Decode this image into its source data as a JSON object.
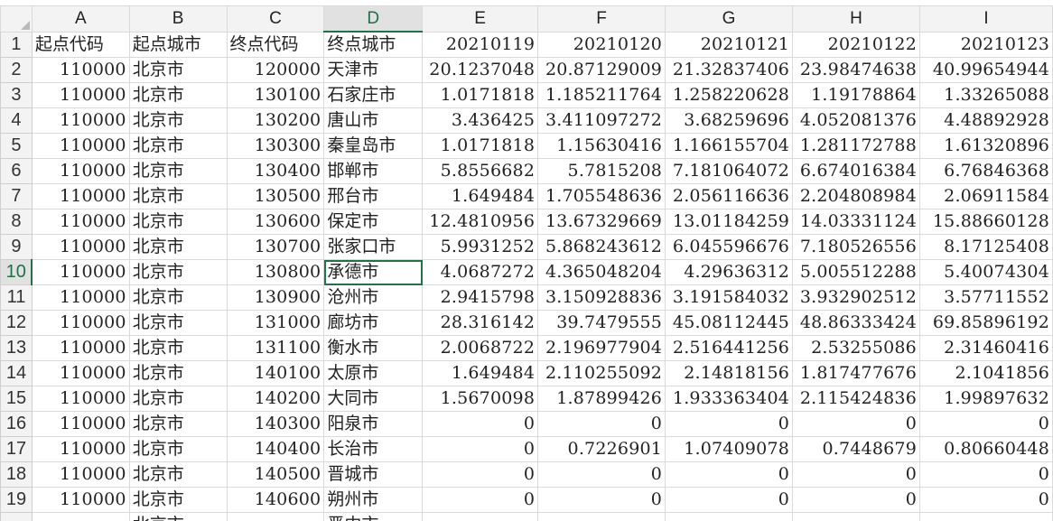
{
  "sheet": {
    "column_headers": [
      "A",
      "B",
      "C",
      "D",
      "E",
      "F",
      "G",
      "H",
      "I"
    ],
    "active_cell": "D10",
    "rows": [
      {
        "row": "1",
        "cells": [
          "起点代码",
          "起点城市",
          "终点代码",
          "终点城市",
          "20210119",
          "20210120",
          "20210121",
          "20210122",
          "20210123"
        ]
      },
      {
        "row": "2",
        "cells": [
          "110000",
          "北京市",
          "120000",
          "天津市",
          "20.1237048",
          "20.87129009",
          "21.32837406",
          "23.98474638",
          "40.99654944"
        ]
      },
      {
        "row": "3",
        "cells": [
          "110000",
          "北京市",
          "130100",
          "石家庄市",
          "1.0171818",
          "1.185211764",
          "1.258220628",
          "1.19178864",
          "1.33265088"
        ]
      },
      {
        "row": "4",
        "cells": [
          "110000",
          "北京市",
          "130200",
          "唐山市",
          "3.436425",
          "3.411097272",
          "3.68259696",
          "4.052081376",
          "4.48892928"
        ]
      },
      {
        "row": "5",
        "cells": [
          "110000",
          "北京市",
          "130300",
          "秦皇岛市",
          "1.0171818",
          "1.15630416",
          "1.166155704",
          "1.281172788",
          "1.61320896"
        ]
      },
      {
        "row": "6",
        "cells": [
          "110000",
          "北京市",
          "130400",
          "邯郸市",
          "5.8556682",
          "5.7815208",
          "7.181064072",
          "6.674016384",
          "6.76846368"
        ]
      },
      {
        "row": "7",
        "cells": [
          "110000",
          "北京市",
          "130500",
          "邢台市",
          "1.649484",
          "1.705548636",
          "2.056116636",
          "2.204808984",
          "2.06911584"
        ]
      },
      {
        "row": "8",
        "cells": [
          "110000",
          "北京市",
          "130600",
          "保定市",
          "12.4810956",
          "13.67329669",
          "13.01184259",
          "14.03331124",
          "15.88660128"
        ]
      },
      {
        "row": "9",
        "cells": [
          "110000",
          "北京市",
          "130700",
          "张家口市",
          "5.9931252",
          "5.868243612",
          "6.045596676",
          "7.180526556",
          "8.17125408"
        ]
      },
      {
        "row": "10",
        "cells": [
          "110000",
          "北京市",
          "130800",
          "承德市",
          "4.0687272",
          "4.365048204",
          "4.29636312",
          "5.005512288",
          "5.40074304"
        ]
      },
      {
        "row": "11",
        "cells": [
          "110000",
          "北京市",
          "130900",
          "沧州市",
          "2.9415798",
          "3.150928836",
          "3.191584032",
          "3.932902512",
          "3.57711552"
        ]
      },
      {
        "row": "12",
        "cells": [
          "110000",
          "北京市",
          "131000",
          "廊坊市",
          "28.316142",
          "39.7479555",
          "45.08112445",
          "48.86333424",
          "69.85896192"
        ]
      },
      {
        "row": "13",
        "cells": [
          "110000",
          "北京市",
          "131100",
          "衡水市",
          "2.0068722",
          "2.196977904",
          "2.516441256",
          "2.53255086",
          "2.31460416"
        ]
      },
      {
        "row": "14",
        "cells": [
          "110000",
          "北京市",
          "140100",
          "太原市",
          "1.649484",
          "2.110255092",
          "2.14818156",
          "1.817477676",
          "2.1041856"
        ]
      },
      {
        "row": "15",
        "cells": [
          "110000",
          "北京市",
          "140200",
          "大同市",
          "1.5670098",
          "1.87899426",
          "1.933363404",
          "2.115424836",
          "1.99897632"
        ]
      },
      {
        "row": "16",
        "cells": [
          "110000",
          "北京市",
          "140300",
          "阳泉市",
          "0",
          "0",
          "0",
          "0",
          "0"
        ]
      },
      {
        "row": "17",
        "cells": [
          "110000",
          "北京市",
          "140400",
          "长治市",
          "0",
          "0.7226901",
          "1.07409078",
          "0.7448679",
          "0.80660448"
        ]
      },
      {
        "row": "18",
        "cells": [
          "110000",
          "北京市",
          "140500",
          "晋城市",
          "0",
          "0",
          "0",
          "0",
          "0"
        ]
      },
      {
        "row": "19",
        "cells": [
          "110000",
          "北京市",
          "140600",
          "朔州市",
          "0",
          "0",
          "0",
          "0",
          "0"
        ]
      }
    ],
    "partial_row": {
      "row": "",
      "cells": [
        "",
        "北京市",
        "",
        "晋中市",
        "",
        "",
        "",
        "",
        ""
      ]
    },
    "colors": {
      "header_bg": "#f3f3f3",
      "active_header_bg": "#e1e1e1",
      "selection": "#217346",
      "gridline": "#dadada"
    }
  }
}
